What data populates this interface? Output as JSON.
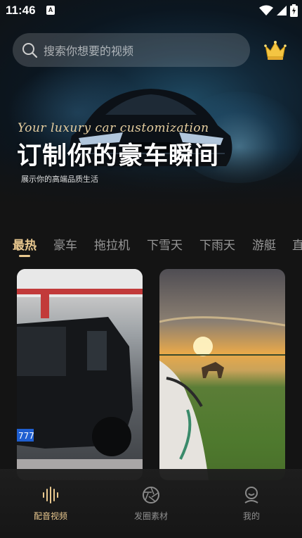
{
  "status_bar": {
    "time": "11:46",
    "notification_badge": "A"
  },
  "search": {
    "placeholder": "搜索你想要的视频",
    "icon": "search-icon"
  },
  "vip": {
    "icon": "crown-icon",
    "color": "#f4c542"
  },
  "banner": {
    "script_text": "Your luxury car customization",
    "title": "订制你的豪车瞬间",
    "subtitle": "展示你的高端品质生活"
  },
  "tabs": [
    {
      "label": "最热",
      "active": true
    },
    {
      "label": "豪车",
      "active": false
    },
    {
      "label": "拖拉机",
      "active": false
    },
    {
      "label": "下雪天",
      "active": false
    },
    {
      "label": "下雨天",
      "active": false
    },
    {
      "label": "游艇",
      "active": false
    },
    {
      "label": "直",
      "active": false
    }
  ],
  "videos": [
    {
      "subject": "black SUV at gas station",
      "plate_fragment": "777"
    },
    {
      "subject": "horse on grassland at sunset"
    }
  ],
  "bottom_nav": [
    {
      "label": "配音视频",
      "icon": "audio-wave-icon",
      "active": true
    },
    {
      "label": "发圈素材",
      "icon": "aperture-icon",
      "active": false
    },
    {
      "label": "我的",
      "icon": "user-icon",
      "active": false
    }
  ],
  "colors": {
    "accent": "#e9c88f",
    "background": "#141414"
  }
}
